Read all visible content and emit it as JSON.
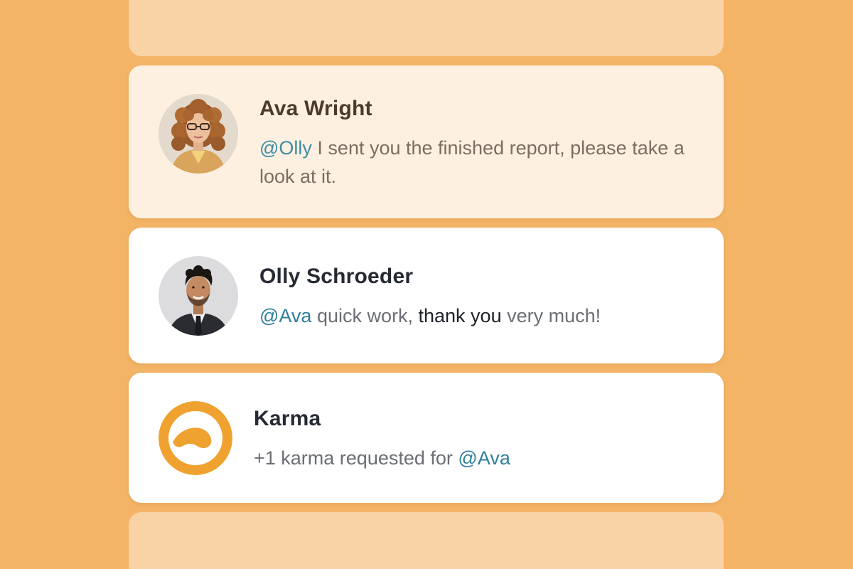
{
  "messages": [
    {
      "name": "Ava Wright",
      "mention": "@Olly",
      "text": " I sent you the finished report, please take a look at it."
    },
    {
      "name": "Olly Schroeder",
      "mention": "@Ava",
      "text_before": " quick work, ",
      "emphasis": "thank you",
      "text_after": " very much!"
    },
    {
      "name": "Karma",
      "text": "+1 karma requested for ",
      "mention": "@Ava"
    }
  ],
  "colors": {
    "background": "#F4B466",
    "accent_mention": "#2E7F9C",
    "karma_brand": "#EFA22F"
  }
}
